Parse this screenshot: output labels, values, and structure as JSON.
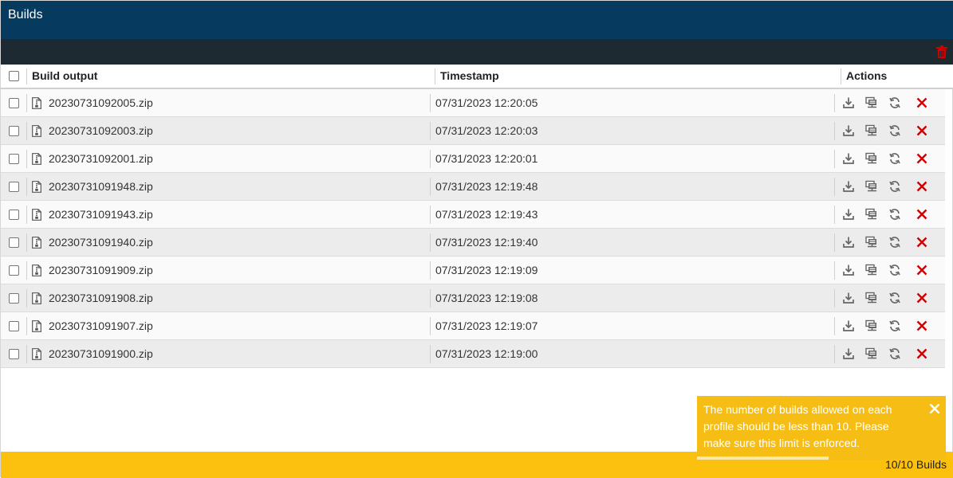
{
  "window": {
    "title": "Builds"
  },
  "table": {
    "headers": {
      "build_output": "Build output",
      "timestamp": "Timestamp",
      "actions": "Actions"
    },
    "rows": [
      {
        "file": "20230731092005.zip",
        "timestamp": "07/31/2023 12:20:05"
      },
      {
        "file": "20230731092003.zip",
        "timestamp": "07/31/2023 12:20:03"
      },
      {
        "file": "20230731092001.zip",
        "timestamp": "07/31/2023 12:20:01"
      },
      {
        "file": "20230731091948.zip",
        "timestamp": "07/31/2023 12:19:48"
      },
      {
        "file": "20230731091943.zip",
        "timestamp": "07/31/2023 12:19:43"
      },
      {
        "file": "20230731091940.zip",
        "timestamp": "07/31/2023 12:19:40"
      },
      {
        "file": "20230731091909.zip",
        "timestamp": "07/31/2023 12:19:09"
      },
      {
        "file": "20230731091908.zip",
        "timestamp": "07/31/2023 12:19:08"
      },
      {
        "file": "20230731091907.zip",
        "timestamp": "07/31/2023 12:19:07"
      },
      {
        "file": "20230731091900.zip",
        "timestamp": "07/31/2023 12:19:00"
      }
    ],
    "row_actions": [
      "download-icon",
      "deploy-icon",
      "refresh-icon",
      "delete-icon"
    ]
  },
  "toolbar": {
    "delete_all_icon": "trash-icon"
  },
  "footer": {
    "count": "10/10 Builds"
  },
  "toast": {
    "message": "The number of builds allowed on each profile should be less than 10. Please make sure this limit is enforced.",
    "close_icon": "close-icon"
  },
  "colors": {
    "header_bg": "#063a5e",
    "toolbar_bg": "#1e2a31",
    "footer_bg": "#fcc10f",
    "toast_bg": "#f6bd14",
    "delete_red": "#d40000"
  }
}
